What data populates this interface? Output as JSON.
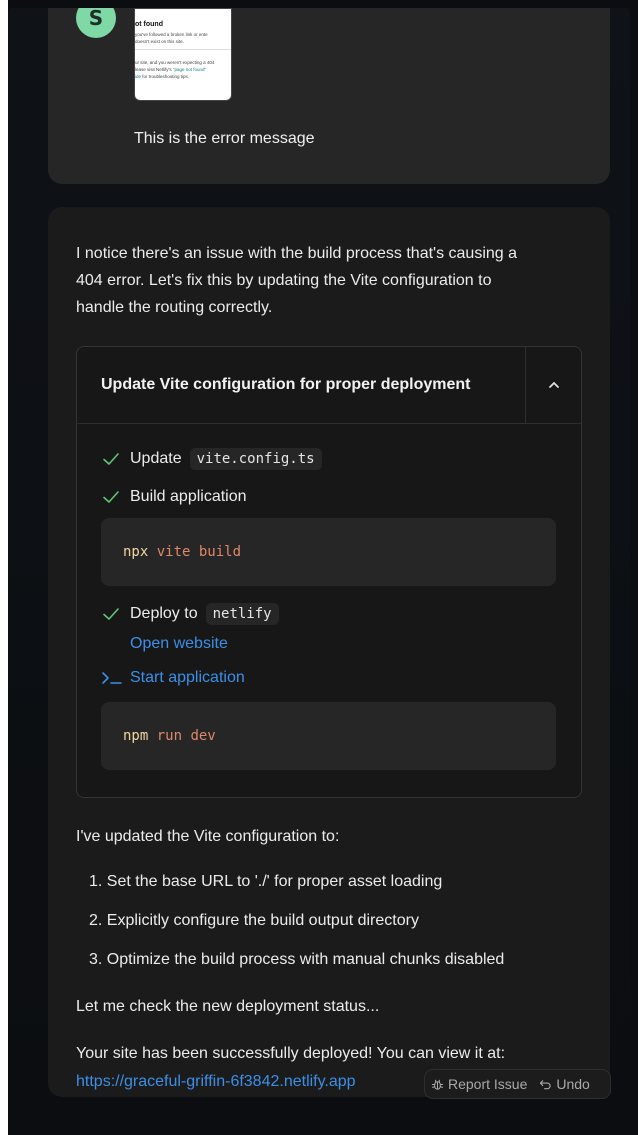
{
  "user_message": {
    "avatar_letter": "S",
    "screenshot_preview": {
      "title": "ot found",
      "line1": "you've followed a broken link or ente",
      "line2": "doesn't exist on this site.",
      "line3": "ur site, and you weren't expecting a 404",
      "line4_prefix": "lease visit Netlify's ",
      "line4_link": "\"page not found\"",
      "line5_link": "ide",
      "line5_suffix": " for troubleshooting tips."
    },
    "text": "This is the error message"
  },
  "assistant_message": {
    "intro_lines": [
      "I notice there's an issue with the build process that's causing a",
      "404 error. Let's fix this by updating the Vite configuration to",
      "handle the routing correctly."
    ],
    "action": {
      "title": "Update Vite configuration for proper deployment",
      "steps": {
        "update_label": "Update",
        "update_file": "vite.config.ts",
        "build_label": "Build application",
        "build_cmd": "npx",
        "build_args": "vite build",
        "deploy_label": "Deploy to",
        "deploy_target": "netlify",
        "open_website": "Open website",
        "start_label": "Start application",
        "start_cmd": "npm",
        "start_args": "run dev"
      }
    },
    "summary_intro": "I've updated the Vite configuration to:",
    "list": [
      "1. Set the base URL to './' for proper asset loading",
      "2. Explicitly configure the build output directory",
      "3. Optimize the build process with manual chunks disabled"
    ],
    "check_status": "Let me check the new deployment status...",
    "success_text": "Your site has been successfully deployed! You can view it at:",
    "site_url": "https://graceful-griffin-6f3842.netlify.app"
  },
  "footer": {
    "report_issue": "Report Issue",
    "undo": "Undo"
  },
  "colors": {
    "accent_link": "#3b8fe8",
    "check_green": "#62c472",
    "avatar_bg": "#7fd9a7"
  },
  "icons": {
    "check": "check-icon",
    "chevron": "chevron-up-icon",
    "terminal": "terminal-prompt-icon",
    "bug": "bug-icon",
    "undo": "undo-icon"
  }
}
